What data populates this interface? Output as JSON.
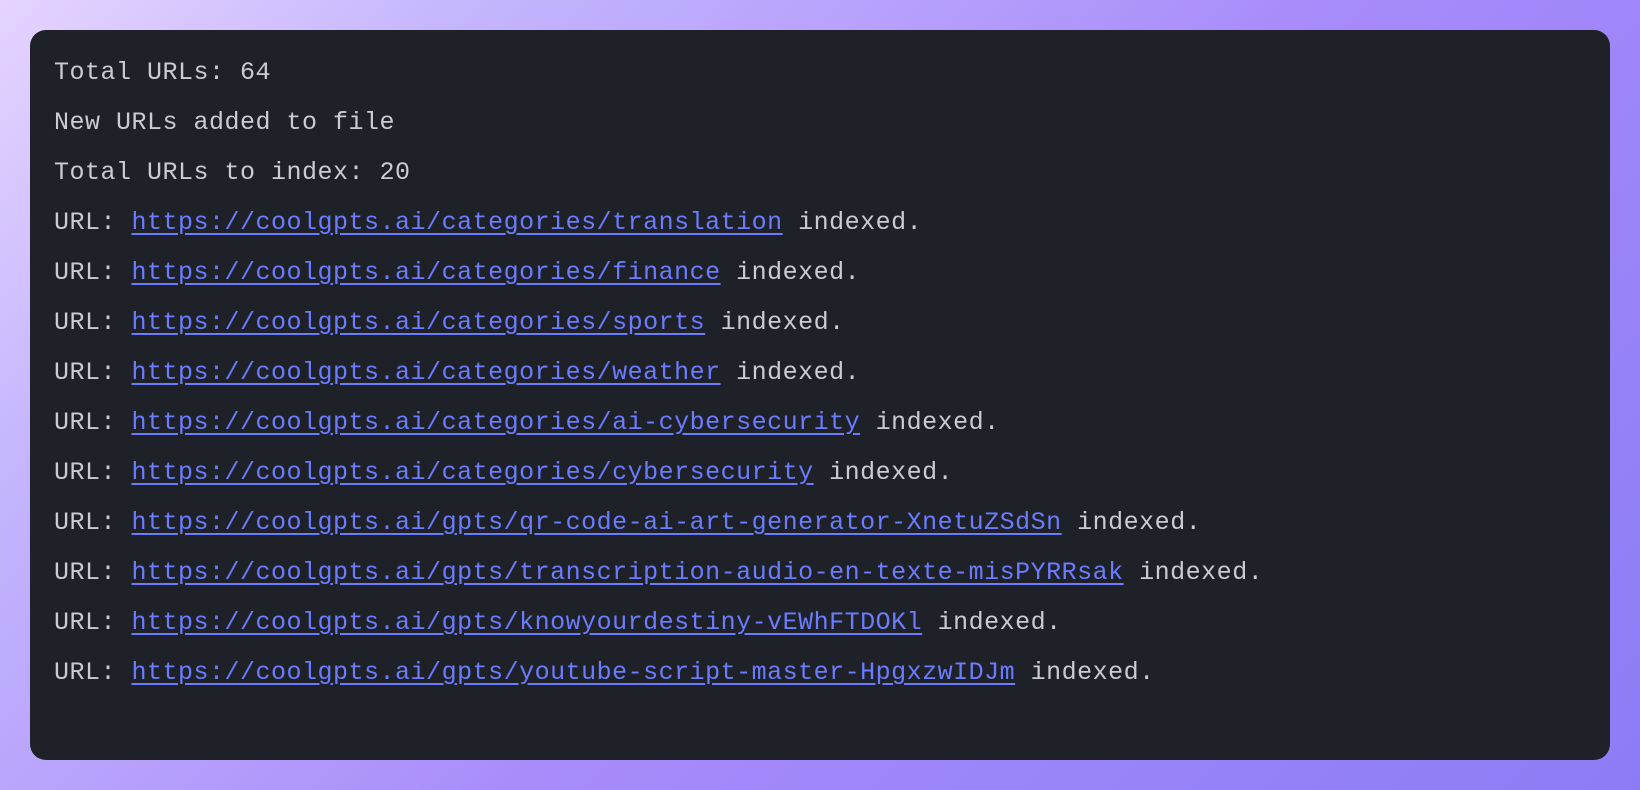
{
  "terminal": {
    "header": {
      "total_urls_label": "Total URLs: 64",
      "new_urls_label": "New URLs added to file",
      "to_index_label": "Total URLs to index: 20"
    },
    "url_prefix": "URL: ",
    "url_suffix": " indexed.",
    "urls": [
      "https://coolgpts.ai/categories/translation",
      "https://coolgpts.ai/categories/finance",
      "https://coolgpts.ai/categories/sports",
      "https://coolgpts.ai/categories/weather",
      "https://coolgpts.ai/categories/ai-cybersecurity",
      "https://coolgpts.ai/categories/cybersecurity",
      "https://coolgpts.ai/gpts/qr-code-ai-art-generator-XnetuZSdSn",
      "https://coolgpts.ai/gpts/transcription-audio-en-texte-misPYRRsak",
      "https://coolgpts.ai/gpts/knowyourdestiny-vEWhFTDOKl",
      "https://coolgpts.ai/gpts/youtube-script-master-HpgxzwIDJm"
    ]
  }
}
